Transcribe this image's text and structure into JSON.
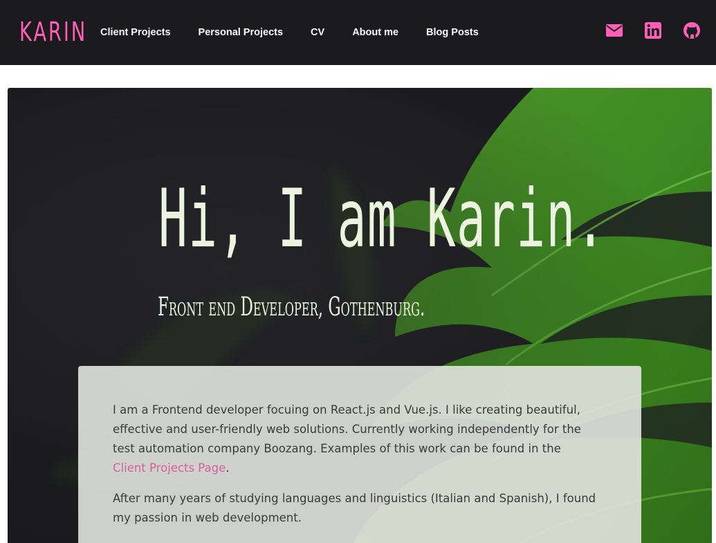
{
  "nav": {
    "brand": "KARIN",
    "links": [
      {
        "label": "Client Projects"
      },
      {
        "label": "Personal Projects"
      },
      {
        "label": "CV"
      },
      {
        "label": "About me"
      },
      {
        "label": "Blog Posts"
      }
    ],
    "icons": [
      "envelope-icon",
      "linkedin-icon",
      "github-icon"
    ],
    "brand_color": "#ff5fb8",
    "icon_color": "#ff5fb8",
    "background": "#1b1a1c"
  },
  "hero": {
    "title": "Hi, I am Karin.",
    "subtitle": "Front end Developer, Gothenburg.",
    "text_color": "#ecf3df"
  },
  "intro": {
    "paragraph1_before_link": "I am a Frontend developer focuing on React.js and Vue.js. I like creating beautiful, effective and user-friendly web solutions. Currently working independently for the test automation company Boozang. Examples of this work can be found in the ",
    "paragraph1_link": "Client Projects Page",
    "paragraph1_after_link": ".",
    "paragraph2": "After many years of studying languages and linguistics (Italian and Spanish), I found my passion in web development.",
    "link_color": "#d6609e"
  }
}
